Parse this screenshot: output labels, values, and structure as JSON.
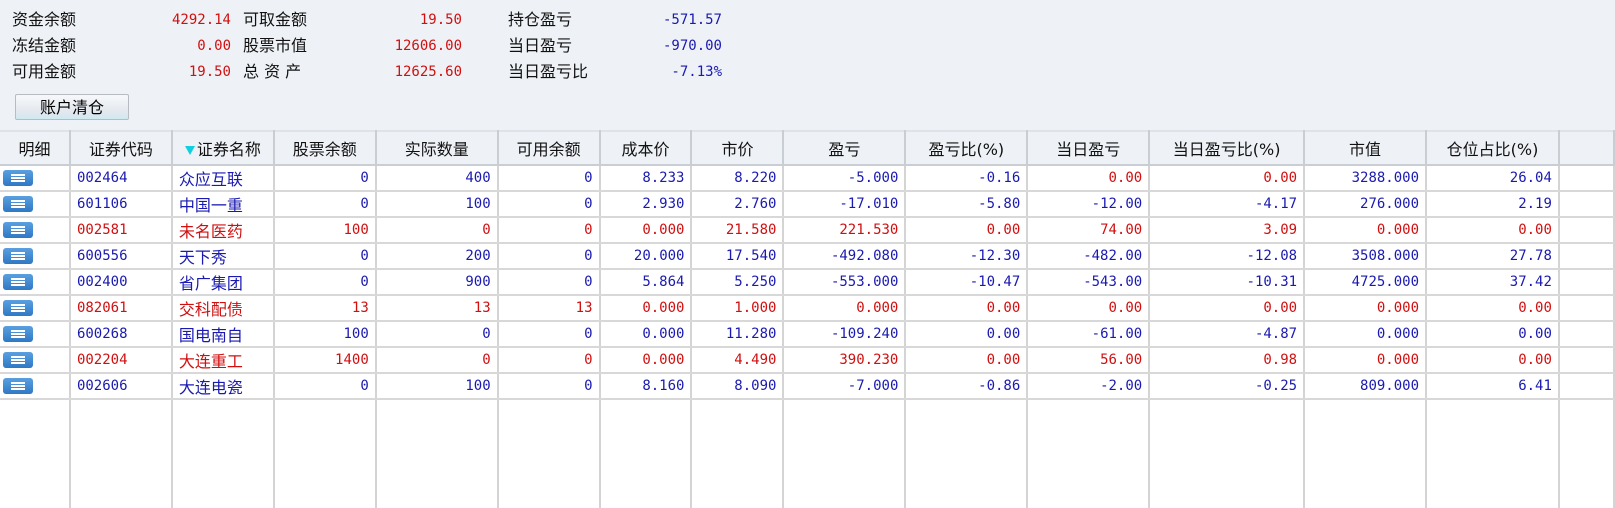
{
  "summary": [
    [
      {
        "label": "资金余额",
        "value": "4292.14"
      },
      {
        "label": "可取金额",
        "value": "19.50"
      },
      {
        "label": "持仓盈亏",
        "value": "-571.57"
      }
    ],
    [
      {
        "label": "冻结金额",
        "value": "0.00"
      },
      {
        "label": "股票市值",
        "value": "12606.00"
      },
      {
        "label": "当日盈亏",
        "value": "-970.00"
      }
    ],
    [
      {
        "label": "可用金额",
        "value": "19.50"
      },
      {
        "label": "总 资 产",
        "value": "12625.60"
      },
      {
        "label": "当日盈亏比",
        "value": "-7.13%"
      }
    ]
  ],
  "clear_button": "账户清仓",
  "columns": [
    "明细",
    "证券代码",
    "证券名称",
    "股票余额",
    "实际数量",
    "可用余额",
    "成本价",
    "市价",
    "盈亏",
    "盈亏比(%)",
    "当日盈亏",
    "当日盈亏比(%)",
    "市值",
    "仓位占比(%)"
  ],
  "rows": [
    {
      "color": "blue",
      "red_cols": [
        10,
        11
      ],
      "cells": [
        "002464",
        "众应互联",
        "0",
        "400",
        "0",
        "8.233",
        "8.220",
        "-5.000",
        "-0.16",
        "0.00",
        "0.00",
        "3288.000",
        "26.04"
      ]
    },
    {
      "color": "blue",
      "cells": [
        "601106",
        "中国一重",
        "0",
        "100",
        "0",
        "2.930",
        "2.760",
        "-17.010",
        "-5.80",
        "-12.00",
        "-4.17",
        "276.000",
        "2.19"
      ]
    },
    {
      "color": "red",
      "cells": [
        "002581",
        "未名医药",
        "100",
        "0",
        "0",
        "0.000",
        "21.580",
        "221.530",
        "0.00",
        "74.00",
        "3.09",
        "0.000",
        "0.00"
      ]
    },
    {
      "color": "blue",
      "cells": [
        "600556",
        "天下秀",
        "0",
        "200",
        "0",
        "20.000",
        "17.540",
        "-492.080",
        "-12.30",
        "-482.00",
        "-12.08",
        "3508.000",
        "27.78"
      ]
    },
    {
      "color": "blue",
      "cells": [
        "002400",
        "省广集团",
        "0",
        "900",
        "0",
        "5.864",
        "5.250",
        "-553.000",
        "-10.47",
        "-543.00",
        "-10.31",
        "4725.000",
        "37.42"
      ]
    },
    {
      "color": "red",
      "cells": [
        "082061",
        "交科配债",
        "13",
        "13",
        "13",
        "0.000",
        "1.000",
        "0.000",
        "0.00",
        "0.00",
        "0.00",
        "0.000",
        "0.00"
      ]
    },
    {
      "color": "blue",
      "cells": [
        "600268",
        "国电南自",
        "100",
        "0",
        "0",
        "0.000",
        "11.280",
        "-109.240",
        "0.00",
        "-61.00",
        "-4.87",
        "0.000",
        "0.00"
      ]
    },
    {
      "color": "red",
      "cells": [
        "002204",
        "大连重工",
        "1400",
        "0",
        "0",
        "0.000",
        "4.490",
        "390.230",
        "0.00",
        "56.00",
        "0.98",
        "0.000",
        "0.00"
      ]
    },
    {
      "color": "blue",
      "cells": [
        "002606",
        "大连电瓷",
        "0",
        "100",
        "0",
        "8.160",
        "8.090",
        "-7.000",
        "-0.86",
        "-2.00",
        "-0.25",
        "809.000",
        "6.41"
      ]
    }
  ]
}
